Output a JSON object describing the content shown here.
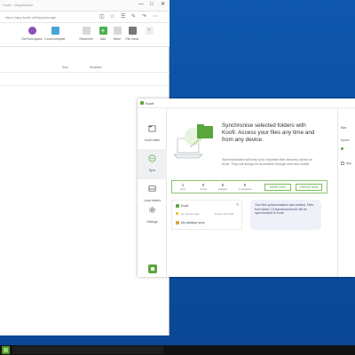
{
  "browser": {
    "tab_title": "Koofr - Mappfaktori",
    "address": "https://app.koofr.net/app/storage",
    "toolbar": [
      {
        "label": "Get from space",
        "color": "#8a4fb8"
      },
      {
        "label": "Local computer",
        "color": "#4aa4d8"
      },
      {
        "label": "Receivers",
        "color": "#bdbdbd"
      },
      {
        "label": "Add",
        "color": "#4caf50"
      },
      {
        "label": "Move",
        "color": "#bdbdbd"
      },
      {
        "label": "File menu",
        "color": "#777777"
      }
    ],
    "columns": {
      "size": "Size",
      "modified": "Modified"
    }
  },
  "koofr": {
    "title": "Koofr",
    "nav": [
      {
        "label": "Koofr folder",
        "icon": "folder-icon"
      },
      {
        "label": "Sync",
        "icon": "sync-icon"
      },
      {
        "label": "Local folders",
        "icon": "drive-icon"
      },
      {
        "label": "Settings",
        "icon": "gear-icon"
      }
    ],
    "heading": "Synchronise selected folders with Koofr. Access your files any time and from any device.",
    "description": "Synchronization will keep your important files securely stored on Koofr. They will always be accessible through web and mobile.",
    "stats": [
      {
        "value": "1",
        "label": "sync"
      },
      {
        "value": "0",
        "label": "errors"
      },
      {
        "value": "0",
        "label": "paused"
      },
      {
        "value": "0",
        "label": "in progress"
      }
    ],
    "more_info_label": "MORE INFO",
    "create_new_label": "CREATE NEW",
    "folder": {
      "source": "Koofr",
      "time": "11 minutes ago",
      "items": "8 items 93.2 KB",
      "target": "My desktop sync"
    },
    "notice": "Your first synchronization was created. Files from folder C:\\Users\\Kone\\Koofr will be synchronized to Koofr.",
    "right_panel": {
      "title": "Koo",
      "sub": "Space",
      "item": "App"
    },
    "accent": "#5aa63d"
  }
}
